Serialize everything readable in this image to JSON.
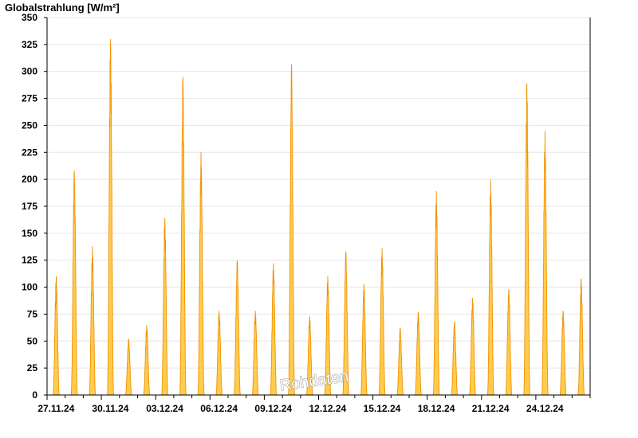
{
  "chart_data": {
    "type": "area",
    "ylabel": "Globalstrahlung [W/m²]",
    "ylim": [
      0,
      350
    ],
    "yticks": [
      0,
      25,
      50,
      75,
      100,
      125,
      150,
      175,
      200,
      225,
      250,
      275,
      300,
      325,
      350
    ],
    "x_start": "27.11.24",
    "x_end": "27.12.24",
    "xtick_labels": [
      "27.11.24",
      "30.11.24",
      "03.12.24",
      "06.12.24",
      "09.12.24",
      "12.12.24",
      "15.12.24",
      "18.12.24",
      "21.12.24",
      "24.12.24"
    ],
    "grid": true,
    "colors": {
      "fill": "#ffcc4d",
      "stroke": "#f29100",
      "grid": "#e6e6e6"
    },
    "watermark": "Rohdaten",
    "series": [
      {
        "daily_peaks": [
          {
            "date": "27.11.24",
            "peak_W_m2": 110
          },
          {
            "date": "28.11.24",
            "peak_W_m2": 208
          },
          {
            "date": "29.11.24",
            "peak_W_m2": 138
          },
          {
            "date": "30.11.24",
            "peak_W_m2": 330
          },
          {
            "date": "01.12.24",
            "peak_W_m2": 52
          },
          {
            "date": "02.12.24",
            "peak_W_m2": 65
          },
          {
            "date": "03.12.24",
            "peak_W_m2": 164
          },
          {
            "date": "04.12.24",
            "peak_W_m2": 295
          },
          {
            "date": "05.12.24",
            "peak_W_m2": 225
          },
          {
            "date": "06.12.24",
            "peak_W_m2": 78
          },
          {
            "date": "07.12.24",
            "peak_W_m2": 125
          },
          {
            "date": "08.12.24",
            "peak_W_m2": 78
          },
          {
            "date": "09.12.24",
            "peak_W_m2": 122
          },
          {
            "date": "10.12.24",
            "peak_W_m2": 307
          },
          {
            "date": "11.12.24",
            "peak_W_m2": 73
          },
          {
            "date": "12.12.24",
            "peak_W_m2": 110
          },
          {
            "date": "13.12.24",
            "peak_W_m2": 133
          },
          {
            "date": "14.12.24",
            "peak_W_m2": 103
          },
          {
            "date": "15.12.24",
            "peak_W_m2": 136
          },
          {
            "date": "16.12.24",
            "peak_W_m2": 62
          },
          {
            "date": "17.12.24",
            "peak_W_m2": 77
          },
          {
            "date": "18.12.24",
            "peak_W_m2": 189
          },
          {
            "date": "19.12.24",
            "peak_W_m2": 68
          },
          {
            "date": "20.12.24",
            "peak_W_m2": 90
          },
          {
            "date": "21.12.24",
            "peak_W_m2": 200
          },
          {
            "date": "22.12.24",
            "peak_W_m2": 98
          },
          {
            "date": "23.12.24",
            "peak_W_m2": 289
          },
          {
            "date": "24.12.24",
            "peak_W_m2": 245
          },
          {
            "date": "25.12.24",
            "peak_W_m2": 78
          },
          {
            "date": "26.12.24",
            "peak_W_m2": 108
          }
        ]
      }
    ]
  }
}
